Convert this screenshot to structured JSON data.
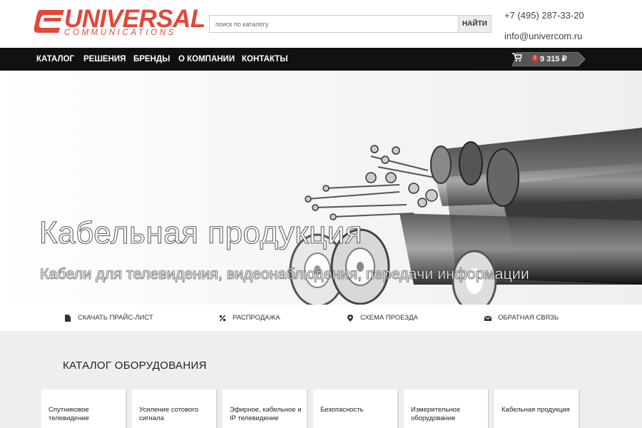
{
  "header": {
    "logo_text": "UNIVERSAL",
    "logo_subtext": "COMMUNICATIONS",
    "search_placeholder": "поиск по каталогу",
    "search_button": "НАЙТИ",
    "phone": "+7 (495) 287-33-20",
    "email": "info@univercom.ru"
  },
  "nav": {
    "items": [
      "КАТАЛОГ",
      "РЕШЕНИЯ",
      "БРЕНДЫ",
      "О КОМПАНИИ",
      "КОНТАКТЫ"
    ],
    "cart_count": "2",
    "cart_total": "9 315 ₽"
  },
  "hero": {
    "title": "Кабельная продукция",
    "subtitle": "Кабели для телевидения, видеонаблюдения, передачи информации"
  },
  "quick_links": [
    {
      "label": "СКАЧАТЬ ПРАЙС-ЛИСТ",
      "icon": "file-icon"
    },
    {
      "label": "РАСПРОДАЖА",
      "icon": "percent-icon"
    },
    {
      "label": "СХЕМА ПРОЕЗДА",
      "icon": "map-pin-icon"
    },
    {
      "label": "ОБРАТНАЯ СВЯЗЬ",
      "icon": "envelope-icon"
    }
  ],
  "catalog": {
    "title": "КАТАЛОГ ОБОРУДОВАНИЯ",
    "cards": [
      "Спутниковое телевидение",
      "Усиление сотового сигнала",
      "Эфирное, кабельное и IP телевидение",
      "Безопасность",
      "Измерительное оборудование",
      "Кабельная продукция"
    ]
  },
  "colors": {
    "brand": "#e2473a",
    "nav_bg": "#111111",
    "cart_bg": "#555555",
    "catalog_bg": "#eeeeee"
  }
}
